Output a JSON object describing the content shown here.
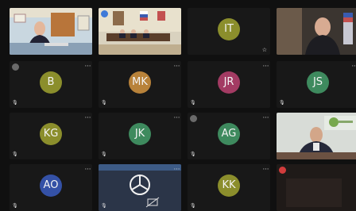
{
  "tiles": [
    {
      "initials": "",
      "kind": "video",
      "scene": "office-single"
    },
    {
      "initials": "",
      "kind": "video",
      "scene": "conference-room"
    },
    {
      "initials": "IT",
      "kind": "avatar",
      "color": "#8b8e2c"
    },
    {
      "initials": "",
      "kind": "video",
      "scene": "office-portrait"
    },
    {
      "initials": "B",
      "kind": "avatar",
      "color": "#8b8e2c"
    },
    {
      "initials": "MK",
      "kind": "avatar",
      "color": "#b8823a"
    },
    {
      "initials": "JR",
      "kind": "avatar",
      "color": "#a33b63"
    },
    {
      "initials": "JS",
      "kind": "avatar",
      "color": "#3e8a5e"
    },
    {
      "initials": "KG",
      "kind": "avatar",
      "color": "#8b8e2c"
    },
    {
      "initials": "JK",
      "kind": "avatar",
      "color": "#3e8a5e"
    },
    {
      "initials": "AG",
      "kind": "avatar",
      "color": "#3e8a5e"
    },
    {
      "initials": "",
      "kind": "video",
      "scene": "office-desk"
    },
    {
      "initials": "AO",
      "kind": "avatar",
      "color": "#3451a6"
    },
    {
      "initials": "",
      "kind": "video",
      "scene": "camera-off"
    },
    {
      "initials": "KK",
      "kind": "avatar",
      "color": "#8b8e2c"
    },
    {
      "initials": "",
      "kind": "video",
      "scene": "dark"
    }
  ],
  "icons": {
    "mic": "microphone-icon",
    "more": "more-options-icon",
    "star": "star-icon",
    "camera_off": "camera-off-icon"
  },
  "colors": {
    "background": "#101010",
    "tile": "#181818",
    "pin_blue": "#3f7ad8",
    "pin_red": "#d23c3c"
  }
}
